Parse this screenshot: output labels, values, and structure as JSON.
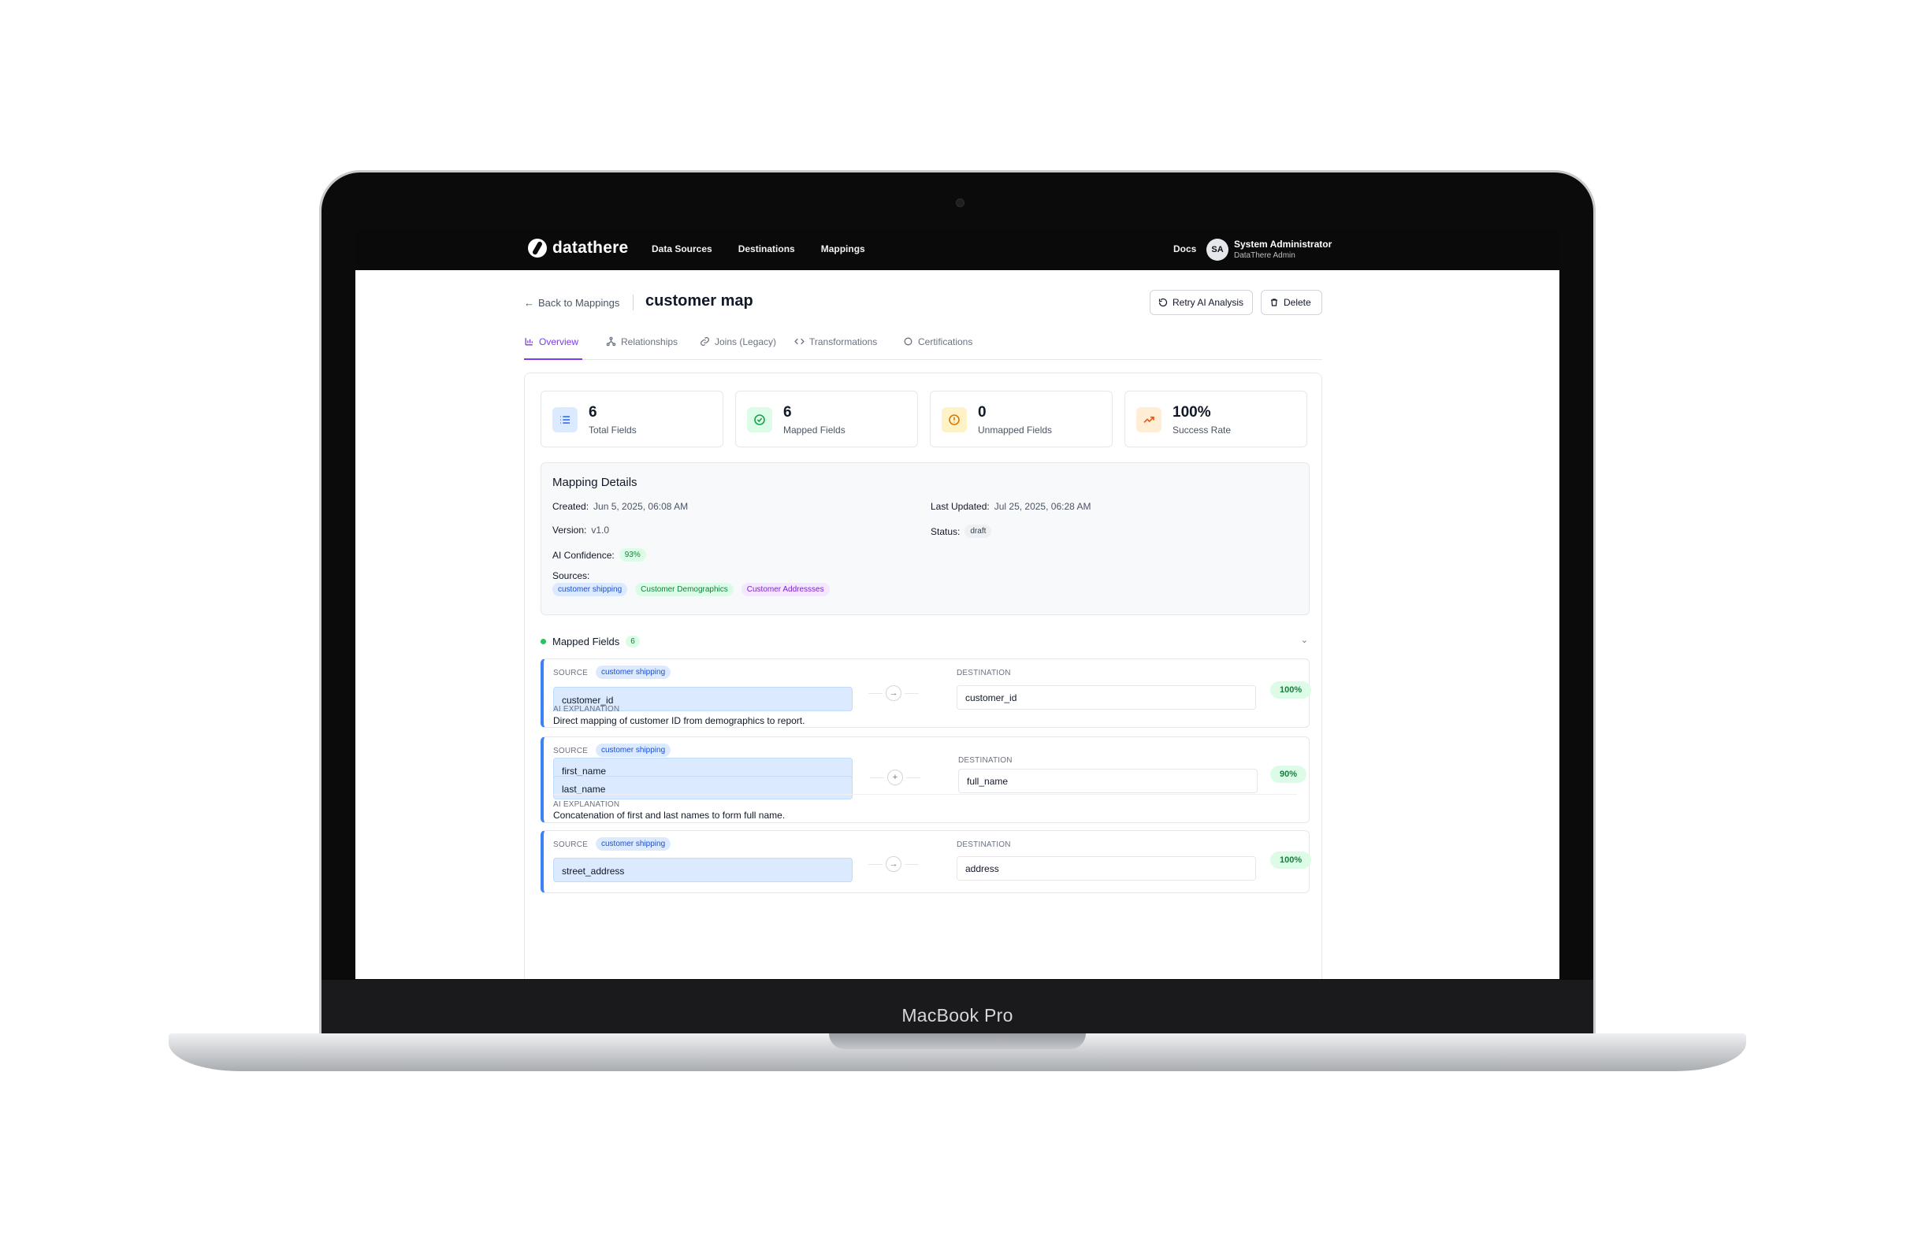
{
  "device": {
    "brand": "MacBook Pro"
  },
  "app": {
    "logo": "datathere"
  },
  "nav": {
    "items": [
      "Data Sources",
      "Destinations",
      "Mappings"
    ],
    "docs": "Docs"
  },
  "user": {
    "initials": "SA",
    "name": "System Administrator",
    "org": "DataThere Admin"
  },
  "header": {
    "back": "Back to Mappings",
    "title": "customer map",
    "retry": "Retry AI Analysis",
    "delete": "Delete"
  },
  "tabs": [
    "Overview",
    "Relationships",
    "Joins (Legacy)",
    "Transformations",
    "Certifications"
  ],
  "stats": [
    {
      "value": "6",
      "label": "Total Fields",
      "icon": "list-icon"
    },
    {
      "value": "6",
      "label": "Mapped Fields",
      "icon": "check-circle-icon"
    },
    {
      "value": "0",
      "label": "Unmapped Fields",
      "icon": "alert-circle-icon"
    },
    {
      "value": "100%",
      "label": "Success Rate",
      "icon": "trending-up-icon"
    }
  ],
  "details": {
    "title": "Mapping Details",
    "created_label": "Created:",
    "created": "Jun 5, 2025, 06:08 AM",
    "updated_label": "Last Updated:",
    "updated": "Jul 25, 2025, 06:28 AM",
    "version_label": "Version:",
    "version": "v1.0",
    "status_label": "Status:",
    "status": "draft",
    "confidence_label": "AI Confidence:",
    "confidence": "93%",
    "sources_label": "Sources:",
    "sources": [
      "customer shipping",
      "Customer Demographics",
      "Customer Addressses"
    ]
  },
  "mapped": {
    "title": "Mapped Fields",
    "count": "6",
    "source_label": "SOURCE",
    "dest_label": "DESTINATION",
    "expl_label": "AI EXPLANATION",
    "cards": [
      {
        "source_tag": "customer shipping",
        "sources": [
          "customer_id"
        ],
        "destination": "customer_id",
        "confidence": "100%",
        "explanation": "Direct mapping of customer ID from demographics to report."
      },
      {
        "source_tag": "customer shipping",
        "sources": [
          "first_name",
          "last_name"
        ],
        "destination": "full_name",
        "confidence": "90%",
        "explanation": "Concatenation of first and last names to form full name."
      },
      {
        "source_tag": "customer shipping",
        "sources": [
          "street_address"
        ],
        "destination": "address",
        "confidence": "100%",
        "explanation": ""
      }
    ]
  },
  "colors": {
    "accent": "#7c3aed",
    "mapped_border": "#3b82f6",
    "success": "#15803d"
  }
}
